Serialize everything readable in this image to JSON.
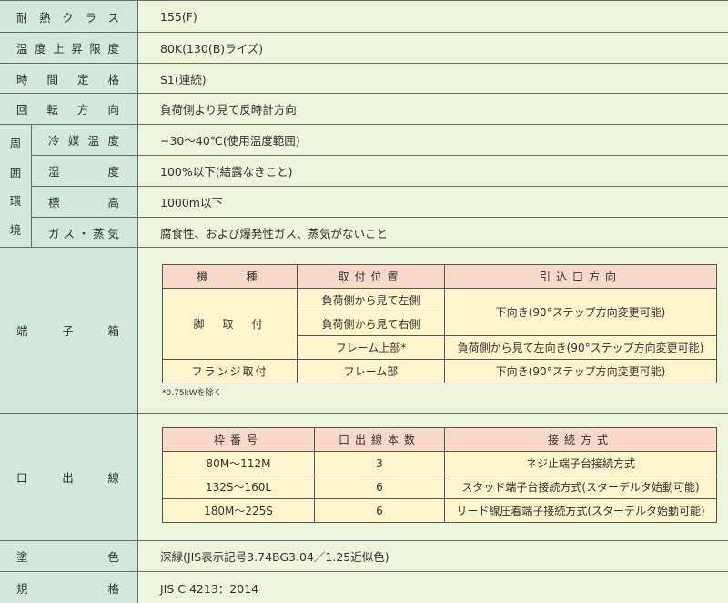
{
  "rows": [
    {
      "label": "耐熱クラス",
      "value": "155(F)"
    },
    {
      "label": "温度上昇限度",
      "value": "80K(130(B)ライズ)"
    },
    {
      "label": "時間定格",
      "value": "S1(連続)"
    },
    {
      "label": "回転方向",
      "value": "負荷側より見て反時計方向"
    }
  ],
  "environment": {
    "group_label": [
      "周",
      "囲",
      "環",
      "境"
    ],
    "items": [
      {
        "label": "冷媒温度",
        "value": "−30〜40℃(使用温度範囲)"
      },
      {
        "label": "湿度",
        "value": "100%以下(結露なきこと)"
      },
      {
        "label": "標高",
        "value": "1000m以下"
      },
      {
        "label": "ガス・蒸気",
        "value": "腐食性、および爆発性ガス、蒸気がないこと"
      }
    ]
  },
  "terminal_box": {
    "label": "端子箱",
    "headers": [
      "機　　種",
      "取付位置",
      "引込口方向"
    ],
    "rows": [
      {
        "model": "脚　取　付",
        "positions": [
          "負荷側から見て左側",
          "負荷側から見て右側",
          "フレーム上部*"
        ],
        "directions": [
          "下向き(90°ステップ方向変更可能)",
          "負荷側から見て左向き(90°ステップ方向変更可能)"
        ]
      },
      {
        "model": "フランジ取付",
        "position": "フレーム部",
        "direction": "下向き(90°ステップ方向変更可能)"
      }
    ],
    "note": "*0.75kWを除く"
  },
  "lead_wires": {
    "label": "口出線",
    "headers": [
      "枠番号",
      "口出線本数",
      "接続方式"
    ],
    "rows": [
      [
        "80M〜112M",
        "3",
        "ネジ止端子台接続方式"
      ],
      [
        "132S〜160L",
        "6",
        "スタッド端子台接続方式(スターデルタ始動可能)"
      ],
      [
        "180M〜225S",
        "6",
        "リード線圧着端子接続方式(スターデルタ始動可能)"
      ]
    ]
  },
  "paint": {
    "label": "塗色",
    "value": "深緑(JIS表示記号3.74BG3.04／1.25近似色)"
  },
  "standard": {
    "label": "規格",
    "value": "JIS C 4213：2014"
  }
}
